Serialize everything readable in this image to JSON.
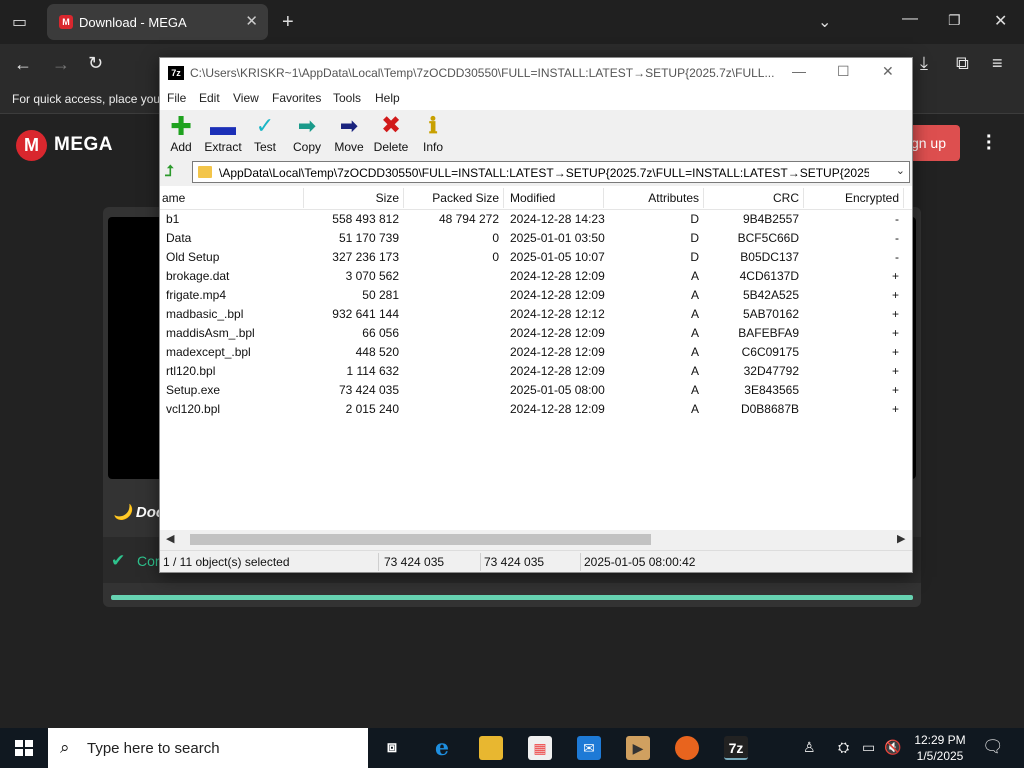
{
  "browser": {
    "tab_title": "Download - MEGA",
    "tab_favicon": "M",
    "favbar_text": "For quick access, place your"
  },
  "mega": {
    "logo_letter": "M",
    "brand": "MEGA",
    "signup_label": "Sign up",
    "download_title_partial": "Doc",
    "status_text_partial": "Cor"
  },
  "sevenzip": {
    "title": "C:\\Users\\KRISKR~1\\AppData\\Local\\Temp\\7zOCDD30550\\FULL=INSTALL:LATEST→SETUP{2025.7z\\FULL...",
    "icon_label": "7z",
    "menu": [
      "File",
      "Edit",
      "View",
      "Favorites",
      "Tools",
      "Help"
    ],
    "toolbar": [
      {
        "label": "Add",
        "icon": "plus-icon",
        "color": "#1fa21f"
      },
      {
        "label": "Extract",
        "icon": "minus-icon",
        "color": "#1b2fb7"
      },
      {
        "label": "Test",
        "icon": "check-icon",
        "color": "#19b6c6"
      },
      {
        "label": "Copy",
        "icon": "copy-arrow-icon",
        "color": "#1a9a8a"
      },
      {
        "label": "Move",
        "icon": "move-arrow-icon",
        "color": "#1a237e"
      },
      {
        "label": "Delete",
        "icon": "delete-x-icon",
        "color": "#d11a1a"
      },
      {
        "label": "Info",
        "icon": "info-icon",
        "color": "#c8a000"
      }
    ],
    "path": "\\AppData\\Local\\Temp\\7zOCDD30550\\FULL=INSTALL:LATEST→SETUP{2025.7z\\FULL=INSTALL:LATEST→SETUP{2025\\",
    "columns": [
      "ame",
      "Size",
      "Packed Size",
      "Modified",
      "Attributes",
      "CRC",
      "Encrypted"
    ],
    "rows": [
      {
        "name": "b1",
        "size": "558 493 812",
        "packed": "48 794 272",
        "modified": "2024-12-28 14:23",
        "attr": "D",
        "crc": "9B4B2557",
        "enc": "-"
      },
      {
        "name": "Data",
        "size": "51 170 739",
        "packed": "0",
        "modified": "2025-01-01 03:50",
        "attr": "D",
        "crc": "BCF5C66D",
        "enc": "-"
      },
      {
        "name": "Old Setup",
        "size": "327 236 173",
        "packed": "0",
        "modified": "2025-01-05 10:07",
        "attr": "D",
        "crc": "B05DC137",
        "enc": "-"
      },
      {
        "name": "brokage.dat",
        "size": "3 070 562",
        "packed": "",
        "modified": "2024-12-28 12:09",
        "attr": "A",
        "crc": "4CD6137D",
        "enc": "+"
      },
      {
        "name": "frigate.mp4",
        "size": "50 281",
        "packed": "",
        "modified": "2024-12-28 12:09",
        "attr": "A",
        "crc": "5B42A525",
        "enc": "+"
      },
      {
        "name": "madbasic_.bpl",
        "size": "932 641 144",
        "packed": "",
        "modified": "2024-12-28 12:12",
        "attr": "A",
        "crc": "5AB70162",
        "enc": "+"
      },
      {
        "name": "maddisAsm_.bpl",
        "size": "66 056",
        "packed": "",
        "modified": "2024-12-28 12:09",
        "attr": "A",
        "crc": "BAFEBFA9",
        "enc": "+"
      },
      {
        "name": "madexcept_.bpl",
        "size": "448 520",
        "packed": "",
        "modified": "2024-12-28 12:09",
        "attr": "A",
        "crc": "C6C09175",
        "enc": "+"
      },
      {
        "name": "rtl120.bpl",
        "size": "1 114 632",
        "packed": "",
        "modified": "2024-12-28 12:09",
        "attr": "A",
        "crc": "32D47792",
        "enc": "+"
      },
      {
        "name": "Setup.exe",
        "size": "73 424 035",
        "packed": "",
        "modified": "2025-01-05 08:00",
        "attr": "A",
        "crc": "3E843565",
        "enc": "+"
      },
      {
        "name": "vcl120.bpl",
        "size": "2 015 240",
        "packed": "",
        "modified": "2024-12-28 12:09",
        "attr": "A",
        "crc": "D0B8687B",
        "enc": "+"
      }
    ],
    "status": {
      "selection": "1 / 11 object(s) selected",
      "size": "73 424 035",
      "packed": "73 424 035",
      "modified": "2025-01-05 08:00:42"
    }
  },
  "taskbar": {
    "search_placeholder": "Type here to search",
    "time": "12:29 PM",
    "date": "1/5/2025",
    "app_7z": "7z"
  }
}
